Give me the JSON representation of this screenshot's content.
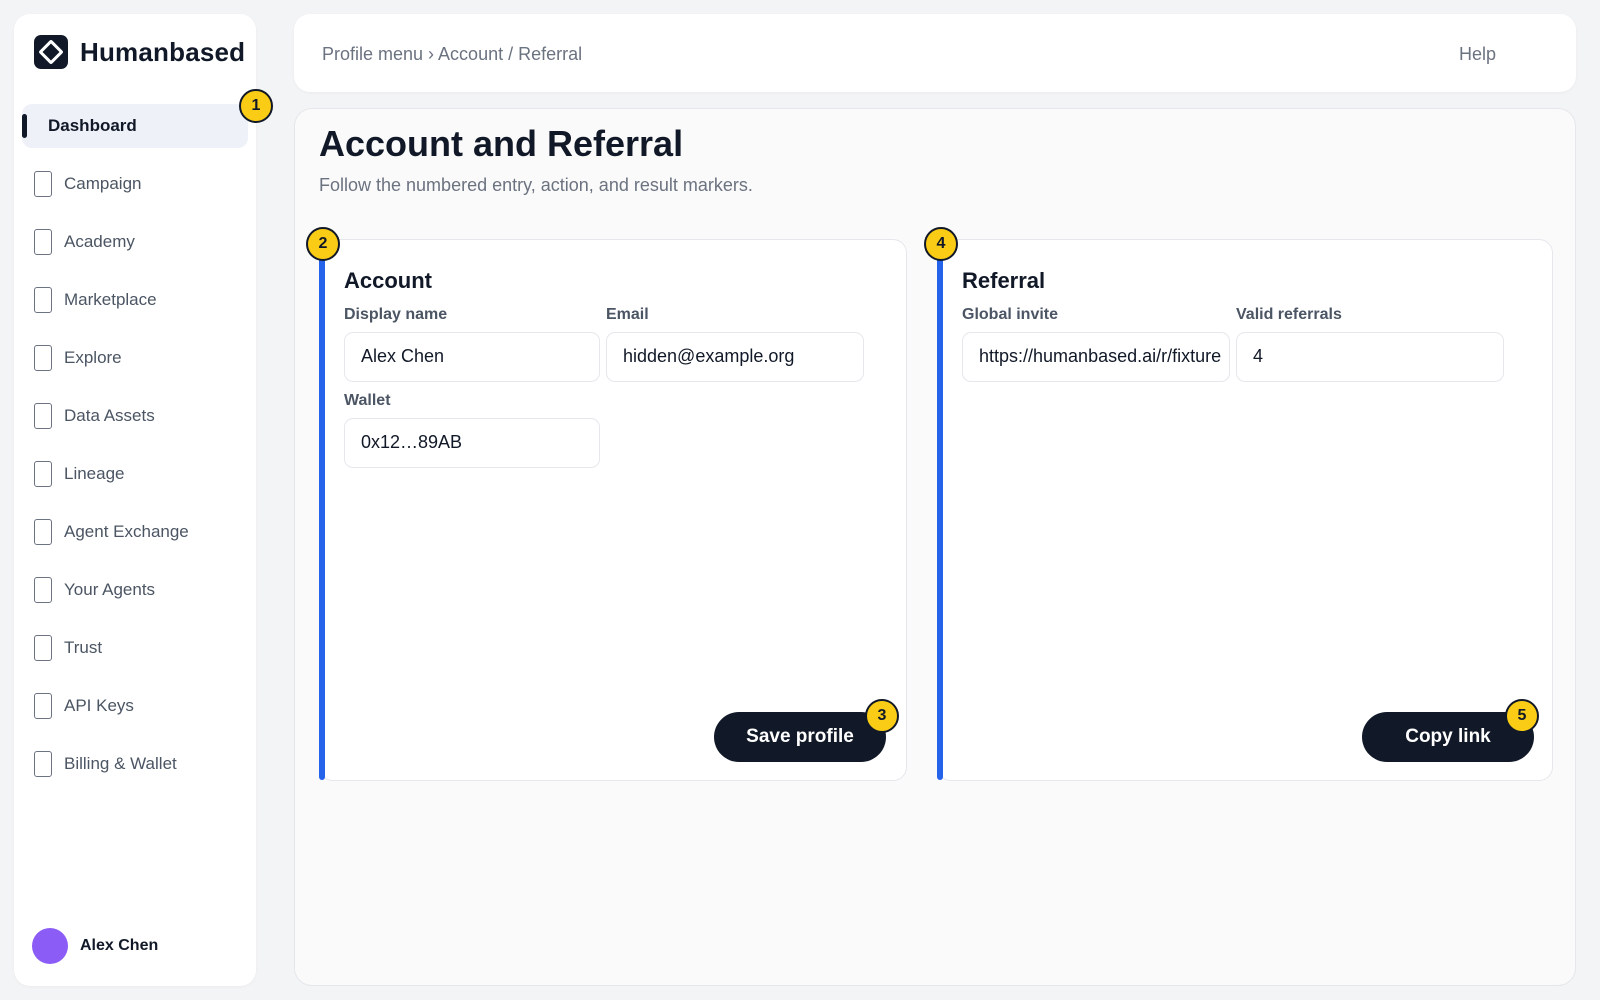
{
  "brand": {
    "name": "Humanbased",
    "logo_icon": "diamond-logo-icon"
  },
  "sidebar": {
    "items": [
      {
        "label": "Dashboard",
        "active": true
      },
      {
        "label": "Campaign"
      },
      {
        "label": "Academy"
      },
      {
        "label": "Marketplace"
      },
      {
        "label": "Explore"
      },
      {
        "label": "Data Assets"
      },
      {
        "label": "Lineage"
      },
      {
        "label": "Agent Exchange"
      },
      {
        "label": "Your Agents"
      },
      {
        "label": "Trust"
      },
      {
        "label": "API Keys"
      },
      {
        "label": "Billing & Wallet"
      }
    ],
    "user": {
      "name": "Alex Chen",
      "avatar_color": "#8b5cf6"
    }
  },
  "header": {
    "breadcrumb": "Profile menu › Account / Referral",
    "help_label": "Help"
  },
  "main": {
    "title": "Account and Referral",
    "subtitle": "Follow the numbered entry, action, and result markers."
  },
  "account": {
    "title": "Account",
    "display_name_label": "Display name",
    "display_name_value": "Alex Chen",
    "email_label": "Email",
    "email_value": "hidden@example.org",
    "wallet_label": "Wallet",
    "wallet_value": "0x12…89AB",
    "save_label": "Save profile"
  },
  "referral": {
    "title": "Referral",
    "invite_label": "Global invite",
    "invite_value": "https://humanbased.ai/r/fixture",
    "valid_label": "Valid referrals",
    "valid_value": "4",
    "copy_label": "Copy link"
  },
  "markers": [
    "1",
    "2",
    "3",
    "4",
    "5"
  ],
  "colors": {
    "accent": "#2563eb",
    "marker": "#facc15",
    "primary_button": "#111827"
  }
}
